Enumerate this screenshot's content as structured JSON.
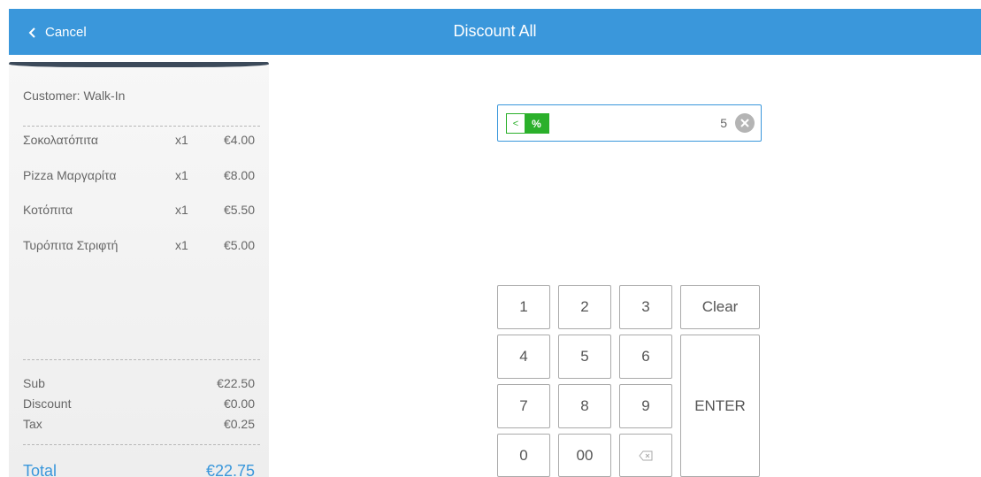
{
  "header": {
    "cancel_label": "Cancel",
    "title": "Discount All",
    "color": "#3a97db"
  },
  "receipt": {
    "customer": "Customer: Walk-In",
    "items": [
      {
        "name": "Σοκολατόπιτα",
        "qty": "x1",
        "price": "€4.00"
      },
      {
        "name": "Pizza Μαργαρίτα",
        "qty": "x1",
        "price": "€8.00"
      },
      {
        "name": "Κοτόπιτα",
        "qty": "x1",
        "price": "€5.50"
      },
      {
        "name": "Τυρόπιτα Στριφτή",
        "qty": "x1",
        "price": "€5.00"
      }
    ],
    "sub_label": "Sub",
    "sub_value": "€22.50",
    "discount_label": "Discount",
    "discount_value": "€0.00",
    "tax_label": "Tax",
    "tax_value": "€0.25",
    "total_label": "Total",
    "total_value": "€22.75"
  },
  "discount_input": {
    "toggle_arrow": "<",
    "mode": "%",
    "value": "5",
    "accent": "#2bb02b"
  },
  "keypad": {
    "k1": "1",
    "k2": "2",
    "k3": "3",
    "clear": "Clear",
    "k4": "4",
    "k5": "5",
    "k6": "6",
    "k7": "7",
    "k8": "8",
    "k9": "9",
    "enter": "ENTER",
    "k0": "0",
    "k00": "00",
    "backspace_icon": "backspace-icon"
  }
}
